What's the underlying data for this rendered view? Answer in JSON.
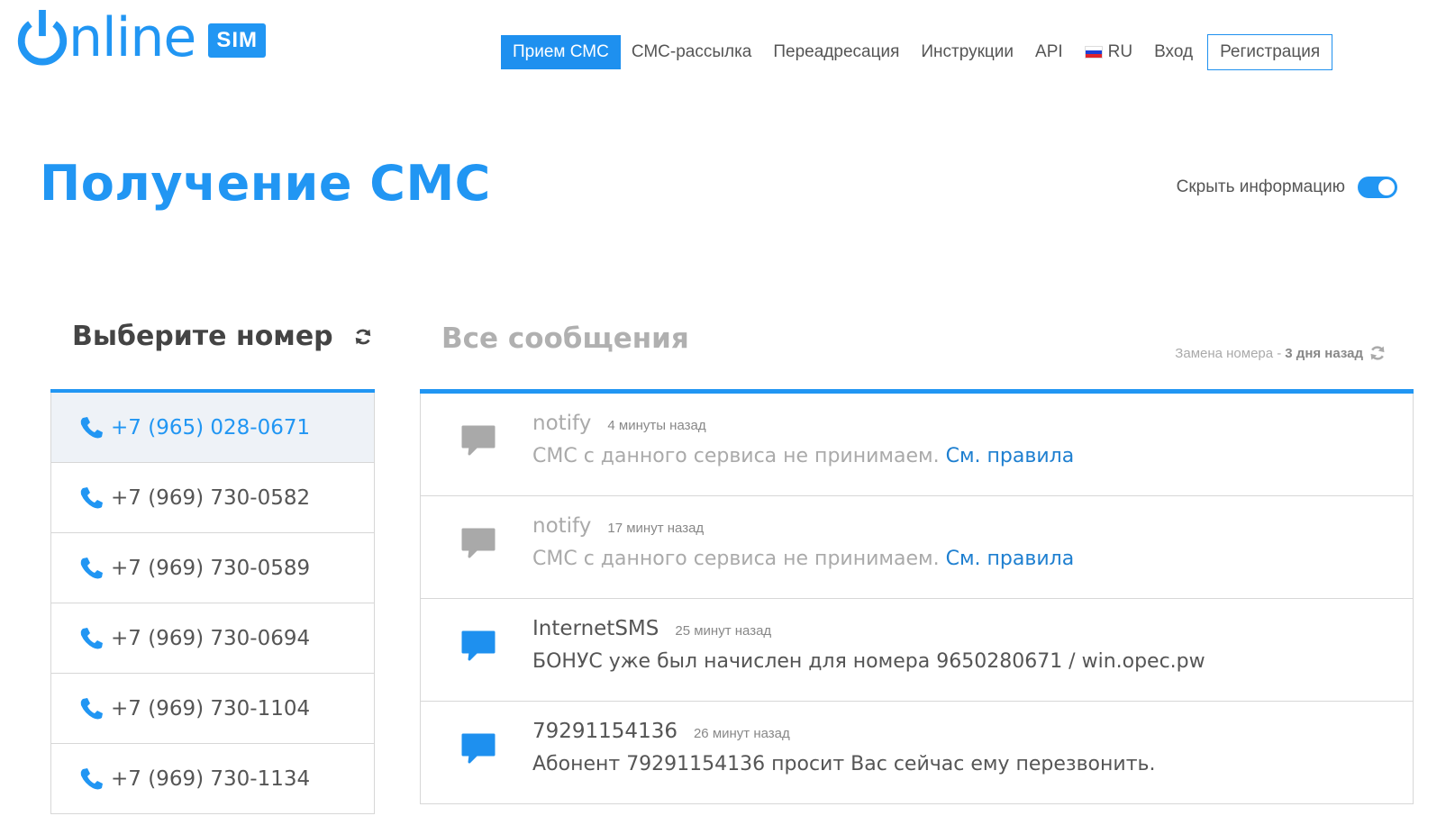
{
  "brand": {
    "logo_text": "nline",
    "badge": "SIM",
    "color": "#2196f3"
  },
  "nav": {
    "items": [
      {
        "label": "Прием СМС",
        "active": true
      },
      {
        "label": "СМС-рассылка"
      },
      {
        "label": "Переадресация"
      },
      {
        "label": "Инструкции"
      },
      {
        "label": "API"
      }
    ],
    "lang": "RU",
    "login": "Вход",
    "register": "Регистрация"
  },
  "page": {
    "title": "Получение СМС",
    "hide_info_label": "Скрыть информацию",
    "hide_info_on": true
  },
  "numbers": {
    "title": "Выберите номер",
    "items": [
      {
        "number": "+7 (965) 028-0671",
        "selected": true
      },
      {
        "number": "+7 (969) 730-0582"
      },
      {
        "number": "+7 (969) 730-0589"
      },
      {
        "number": "+7 (969) 730-0694"
      },
      {
        "number": "+7 (969) 730-1104"
      },
      {
        "number": "+7 (969) 730-1134"
      }
    ]
  },
  "messages": {
    "title": "Все сообщения",
    "replace_label": "Замена номера -",
    "replace_time": "3 дня назад",
    "items": [
      {
        "sender": "notify",
        "time": "4 минуты назад",
        "text": "СМС с данного сервиса не принимаем.",
        "link": "См. правила",
        "muted": true
      },
      {
        "sender": "notify",
        "time": "17 минут назад",
        "text": "СМС с данного сервиса не принимаем.",
        "link": "См. правила",
        "muted": true
      },
      {
        "sender": "InternetSMS",
        "time": "25 минут назад",
        "text": "БОНУС уже был начислен для номера 9650280671 / win.opec.pw"
      },
      {
        "sender": "79291154136",
        "time": "26 минут назад",
        "text": "Абонент 79291154136 просит Вас сейчас ему перезвонить."
      }
    ]
  },
  "icons": {
    "logo": "power-icon",
    "phone": "phone-icon",
    "message": "chat-bubble-icon",
    "refresh": "refresh-icon",
    "flag": "russia-flag-icon"
  }
}
